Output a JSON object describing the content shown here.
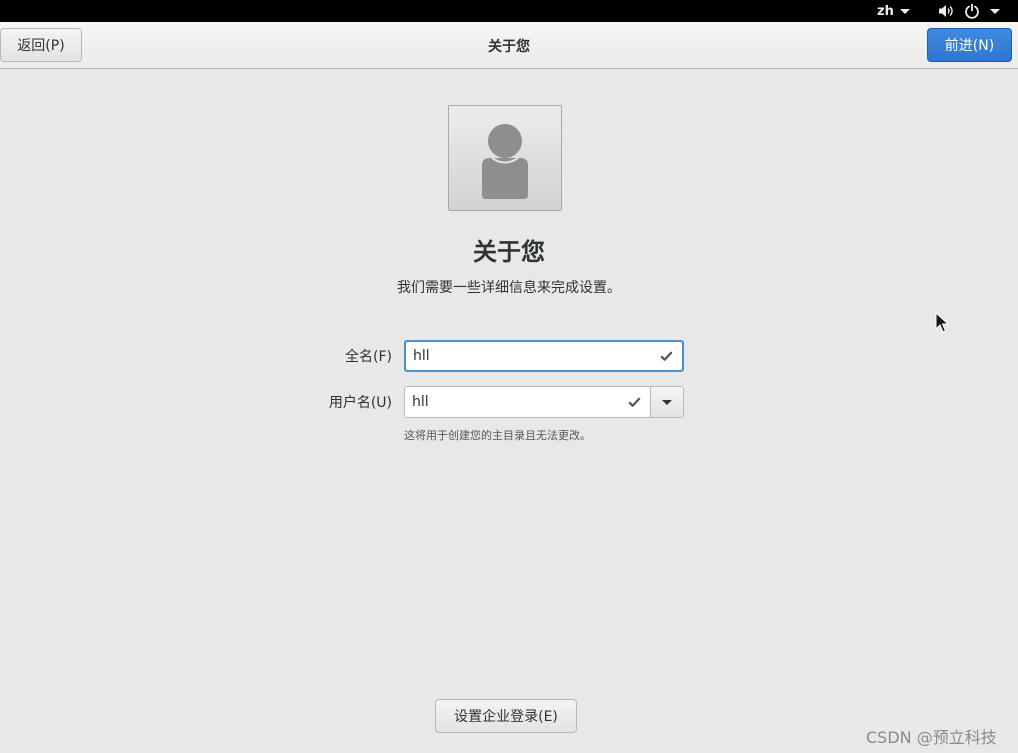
{
  "topbar": {
    "language": "zh",
    "icons": [
      "volume-icon",
      "power-icon"
    ]
  },
  "header": {
    "title": "关于您",
    "back_label": "返回(P)",
    "next_label": "前进(N)"
  },
  "main": {
    "avatar_icon": "user-avatar-icon",
    "title": "关于您",
    "subtitle": "我们需要一些详细信息来完成设置。",
    "fullname": {
      "label": "全名(F)",
      "value": "hll"
    },
    "username": {
      "label": "用户名(U)",
      "value": "hll",
      "hint": "这将用于创建您的主目录且无法更改。"
    },
    "enterprise_label": "设置企业登录(E)"
  },
  "colors": {
    "accent": "#3584e4",
    "background": "#e8e8e7",
    "text": "#2e3436"
  },
  "watermark": "CSDN @预立科技"
}
